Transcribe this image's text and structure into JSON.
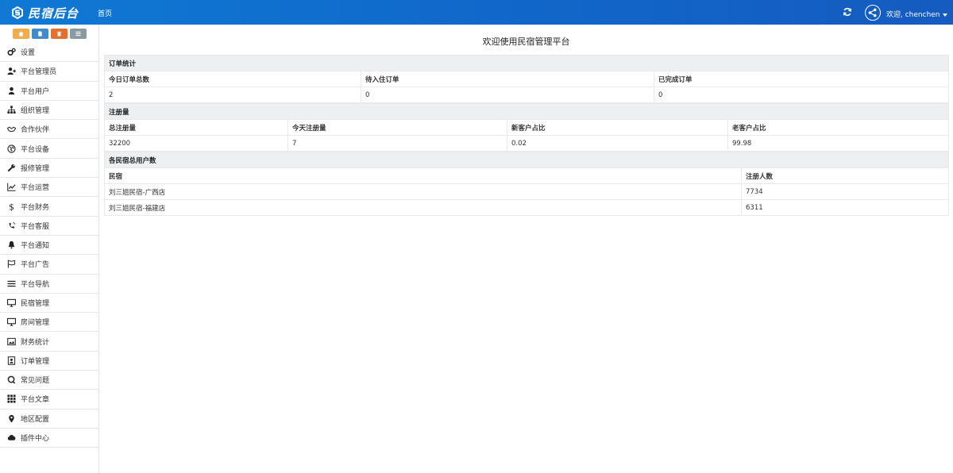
{
  "header": {
    "brand": "民宿后台",
    "nav_home": "首页",
    "welcome": "欢迎, chenchen"
  },
  "sidebar": {
    "quick_buttons": [
      {
        "icon": "home-icon",
        "color": "#f0ad4e"
      },
      {
        "icon": "file-icon",
        "color": "#428bca"
      },
      {
        "icon": "trash-icon",
        "color": "#e4702f"
      },
      {
        "icon": "list-icon",
        "color": "#8b9aa0"
      }
    ],
    "items": [
      {
        "label": "设置",
        "icon": "gears-icon"
      },
      {
        "label": "平台管理员",
        "icon": "user-plus-icon"
      },
      {
        "label": "平台用户",
        "icon": "user-icon"
      },
      {
        "label": "组织管理",
        "icon": "sitemap-icon"
      },
      {
        "label": "合作伙伴",
        "icon": "handshake-icon"
      },
      {
        "label": "平台设备",
        "icon": "globe-icon"
      },
      {
        "label": "报修管理",
        "icon": "wrench-icon"
      },
      {
        "label": "平台运营",
        "icon": "line-chart-icon"
      },
      {
        "label": "平台财务",
        "icon": "dollar-icon"
      },
      {
        "label": "平台客服",
        "icon": "phone-icon"
      },
      {
        "label": "平台通知",
        "icon": "bell-icon"
      },
      {
        "label": "平台广告",
        "icon": "flag-icon"
      },
      {
        "label": "平台导航",
        "icon": "bars-icon"
      },
      {
        "label": "民宿管理",
        "icon": "monitor-icon"
      },
      {
        "label": "房间管理",
        "icon": "monitor-icon"
      },
      {
        "label": "财务统计",
        "icon": "picture-icon"
      },
      {
        "label": "订单管理",
        "icon": "contact-icon"
      },
      {
        "label": "常见问题",
        "icon": "question-icon"
      },
      {
        "label": "平台文章",
        "icon": "grid-icon"
      },
      {
        "label": "地区配置",
        "icon": "map-marker-icon"
      },
      {
        "label": "插件中心",
        "icon": "cloud-icon"
      }
    ]
  },
  "main": {
    "title": "欢迎使用民宿管理平台",
    "orders": {
      "section": "订单统计",
      "headers": [
        "今日订单总数",
        "待入住订单",
        "已完成订单"
      ],
      "values": [
        "2",
        "0",
        "0"
      ]
    },
    "registration": {
      "section": "注册量",
      "headers": [
        "总注册量",
        "今天注册量",
        "新客户占比",
        "老客户占比"
      ],
      "values": [
        "32200",
        "7",
        "0.02",
        "99.98"
      ]
    },
    "homestay_users": {
      "section": "各民宿总用户数",
      "headers": [
        "民宿",
        "注册人数"
      ],
      "rows": [
        [
          "刘三姐民宿-广西店",
          "7734"
        ],
        [
          "刘三姐民宿-福建店",
          "6311"
        ]
      ]
    }
  }
}
